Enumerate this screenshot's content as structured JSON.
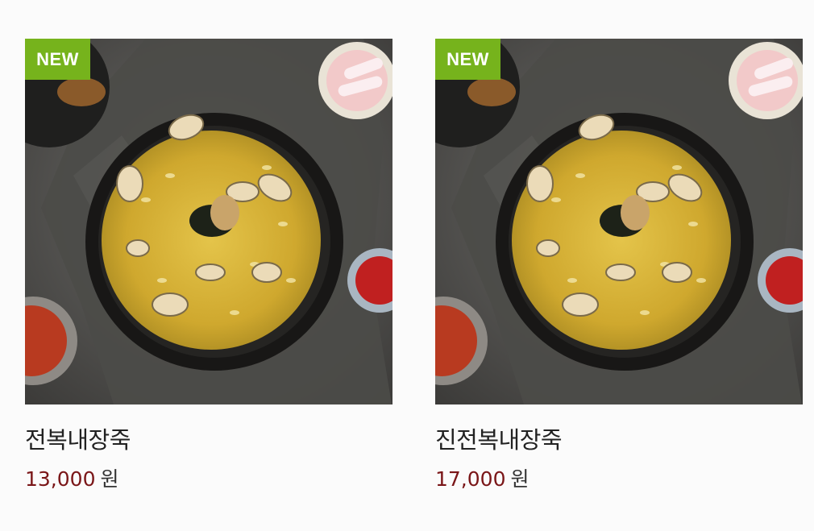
{
  "products": [
    {
      "badge": "NEW",
      "name": "전복내장죽",
      "price": "13,000",
      "currency": "원",
      "image_icon": "porridge-bowl-photo"
    },
    {
      "badge": "NEW",
      "name": "진전복내장죽",
      "price": "17,000",
      "currency": "원",
      "image_icon": "porridge-bowl-photo"
    }
  ],
  "colors": {
    "badge_bg": "#76b31c",
    "price_color": "#7a1618",
    "name_color": "#222222"
  }
}
